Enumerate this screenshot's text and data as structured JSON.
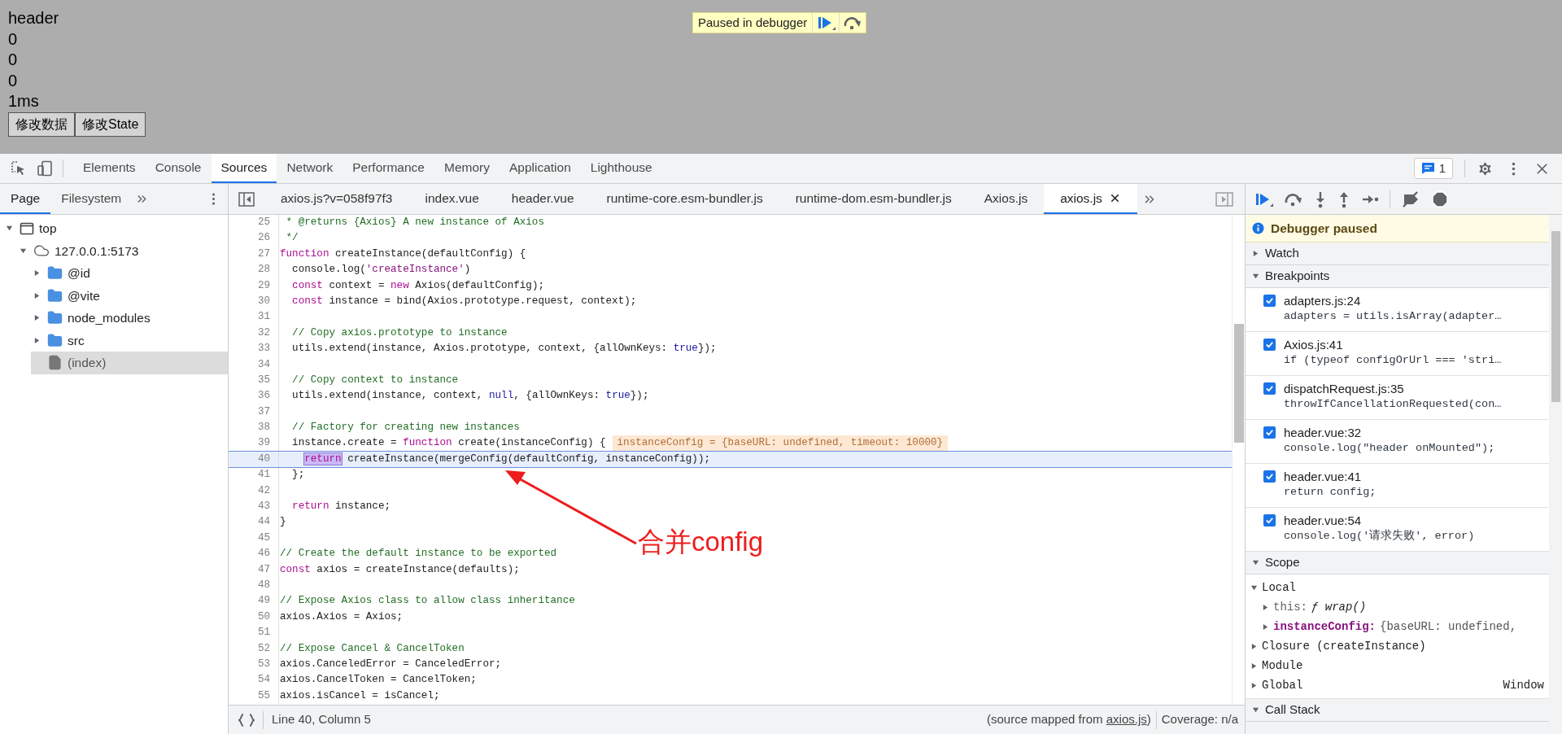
{
  "page": {
    "lines": [
      "header",
      "0",
      "0",
      "0",
      "1ms"
    ],
    "buttons": [
      "修改数据",
      "修改State"
    ],
    "paused_overlay": {
      "label": "Paused in debugger"
    }
  },
  "devtools": {
    "tabs": [
      {
        "label": "Elements",
        "selected": false
      },
      {
        "label": "Console",
        "selected": false
      },
      {
        "label": "Sources",
        "selected": true
      },
      {
        "label": "Network",
        "selected": false
      },
      {
        "label": "Performance",
        "selected": false
      },
      {
        "label": "Memory",
        "selected": false
      },
      {
        "label": "Application",
        "selected": false
      },
      {
        "label": "Lighthouse",
        "selected": false
      }
    ],
    "issues_count": "1"
  },
  "navigator": {
    "tabs": [
      {
        "label": "Page",
        "selected": true
      },
      {
        "label": "Filesystem",
        "selected": false
      }
    ],
    "tree": [
      {
        "label": "top",
        "kind": "frame",
        "expanded": true,
        "selected": false,
        "children": [
          {
            "label": "127.0.0.1:5173",
            "kind": "origin",
            "expanded": true,
            "selected": false,
            "children": [
              {
                "label": "@id",
                "kind": "folder",
                "expanded": false,
                "selected": false
              },
              {
                "label": "@vite",
                "kind": "folder",
                "expanded": false,
                "selected": false
              },
              {
                "label": "node_modules",
                "kind": "folder",
                "expanded": false,
                "selected": false
              },
              {
                "label": "src",
                "kind": "folder",
                "expanded": false,
                "selected": false
              },
              {
                "label": "(index)",
                "kind": "file",
                "selected": true
              }
            ]
          }
        ]
      }
    ]
  },
  "editor": {
    "tabs": [
      {
        "label": "axios.js?v=058f97f3",
        "selected": false
      },
      {
        "label": "index.vue",
        "selected": false
      },
      {
        "label": "header.vue",
        "selected": false
      },
      {
        "label": "runtime-core.esm-bundler.js",
        "selected": false
      },
      {
        "label": "runtime-dom.esm-bundler.js",
        "selected": false
      },
      {
        "label": "Axios.js",
        "selected": false
      },
      {
        "label": "axios.js",
        "selected": true
      }
    ],
    "lines": [
      {
        "number": "25",
        "current": false,
        "tokens": [
          {
            "kind": "comment",
            "text": " * @returns {Axios} A new instance of Axios"
          }
        ]
      },
      {
        "number": "26",
        "current": false,
        "tokens": [
          {
            "kind": "comment",
            "text": " */"
          }
        ]
      },
      {
        "number": "27",
        "current": false,
        "tokens": [
          {
            "kind": "keyword",
            "text": "function"
          },
          {
            "kind": "plain",
            "text": " createInstance(defaultConfig) {"
          }
        ]
      },
      {
        "number": "28",
        "current": false,
        "tokens": [
          {
            "kind": "plain",
            "text": "  console.log("
          },
          {
            "kind": "string",
            "text": "'createInstance'"
          },
          {
            "kind": "plain",
            "text": ")"
          }
        ]
      },
      {
        "number": "29",
        "current": false,
        "tokens": [
          {
            "kind": "keyword",
            "text": "  const"
          },
          {
            "kind": "plain",
            "text": " context = "
          },
          {
            "kind": "keyword",
            "text": "new"
          },
          {
            "kind": "plain",
            "text": " Axios(defaultConfig);"
          }
        ]
      },
      {
        "number": "30",
        "current": false,
        "tokens": [
          {
            "kind": "keyword",
            "text": "  const"
          },
          {
            "kind": "plain",
            "text": " instance = bind(Axios.prototype.request, context);"
          }
        ]
      },
      {
        "number": "31",
        "current": false
      },
      {
        "number": "32",
        "current": false,
        "tokens": [
          {
            "kind": "comment",
            "text": "  // Copy axios.prototype to instance"
          }
        ]
      },
      {
        "number": "33",
        "current": false,
        "tokens": [
          {
            "kind": "plain",
            "text": "  utils.extend(instance, Axios.prototype, context, {allOwnKeys: "
          },
          {
            "kind": "literal",
            "text": "true"
          },
          {
            "kind": "plain",
            "text": "});"
          }
        ]
      },
      {
        "number": "34",
        "current": false
      },
      {
        "number": "35",
        "current": false,
        "tokens": [
          {
            "kind": "comment",
            "text": "  // Copy context to instance"
          }
        ]
      },
      {
        "number": "36",
        "current": false,
        "tokens": [
          {
            "kind": "plain",
            "text": "  utils.extend(instance, context, "
          },
          {
            "kind": "literal",
            "text": "null"
          },
          {
            "kind": "plain",
            "text": ", {allOwnKeys: "
          },
          {
            "kind": "literal",
            "text": "true"
          },
          {
            "kind": "plain",
            "text": "});"
          }
        ]
      },
      {
        "number": "37",
        "current": false
      },
      {
        "number": "38",
        "current": false,
        "tokens": [
          {
            "kind": "comment",
            "text": "  // Factory for creating new instances"
          }
        ]
      },
      {
        "number": "39",
        "current": false,
        "tokens": [
          {
            "kind": "plain",
            "text": "  instance.create = "
          },
          {
            "kind": "keyword",
            "text": "function"
          },
          {
            "kind": "plain",
            "text": " create(instanceConfig) {"
          }
        ],
        "inline_value": "instanceConfig = {baseURL: undefined, timeout: 10000}"
      },
      {
        "number": "40",
        "current": true,
        "deep_indent": true,
        "tokens": [
          {
            "kind": "execution",
            "text": "return"
          },
          {
            "kind": "plain",
            "text": " createInstance(mergeConfig(defaultConfig, instanceConfig));"
          }
        ]
      },
      {
        "number": "41",
        "current": false,
        "tokens": [
          {
            "kind": "plain",
            "text": "  };"
          }
        ]
      },
      {
        "number": "42",
        "current": false
      },
      {
        "number": "43",
        "current": false,
        "tokens": [
          {
            "kind": "keyword",
            "text": "  return"
          },
          {
            "kind": "plain",
            "text": " instance;"
          }
        ]
      },
      {
        "number": "44",
        "current": false,
        "tokens": [
          {
            "kind": "plain",
            "text": "}"
          }
        ]
      },
      {
        "number": "45",
        "current": false
      },
      {
        "number": "46",
        "current": false,
        "tokens": [
          {
            "kind": "comment",
            "text": "// Create the default instance to be exported"
          }
        ]
      },
      {
        "number": "47",
        "current": false,
        "tokens": [
          {
            "kind": "keyword",
            "text": "const"
          },
          {
            "kind": "plain",
            "text": " axios = createInstance(defaults);"
          }
        ]
      },
      {
        "number": "48",
        "current": false
      },
      {
        "number": "49",
        "current": false,
        "tokens": [
          {
            "kind": "comment",
            "text": "// Expose Axios class to allow class inheritance"
          }
        ]
      },
      {
        "number": "50",
        "current": false,
        "tokens": [
          {
            "kind": "plain",
            "text": "axios.Axios = Axios;"
          }
        ]
      },
      {
        "number": "51",
        "current": false
      },
      {
        "number": "52",
        "current": false,
        "tokens": [
          {
            "kind": "comment",
            "text": "// Expose Cancel & CancelToken"
          }
        ]
      },
      {
        "number": "53",
        "current": false,
        "tokens": [
          {
            "kind": "plain",
            "text": "axios.CanceledError = CanceledError;"
          }
        ]
      },
      {
        "number": "54",
        "current": false,
        "tokens": [
          {
            "kind": "plain",
            "text": "axios.CancelToken = CancelToken;"
          }
        ]
      },
      {
        "number": "55",
        "current": false,
        "tokens": [
          {
            "kind": "plain",
            "text": "axios.isCancel = isCancel;"
          }
        ]
      }
    ],
    "annotation": {
      "text": "合并config"
    },
    "status_bar": {
      "position": "Line 40, Column 5",
      "source_prefix": "(source mapped from",
      "source_link": "axios.js",
      "source_suffix": ")",
      "coverage": "Coverage: n/a"
    }
  },
  "debugger": {
    "banner": "Debugger paused",
    "sections": [
      {
        "kind": "watch",
        "title": "Watch",
        "expanded": false
      },
      {
        "kind": "breakpoints",
        "title": "Breakpoints",
        "expanded": true,
        "items": [
          {
            "location": "adapters.js:24",
            "code": "adapters = utils.isArray(adapter…",
            "checked": true
          },
          {
            "location": "Axios.js:41",
            "code": "if (typeof configOrUrl === 'stri…",
            "checked": true
          },
          {
            "location": "dispatchRequest.js:35",
            "code": "throwIfCancellationRequested(con…",
            "checked": true
          },
          {
            "location": "header.vue:32",
            "code": "console.log(\"header onMounted\");",
            "checked": true
          },
          {
            "location": "header.vue:41",
            "code": "return config;",
            "checked": true
          },
          {
            "location": "header.vue:54",
            "code": "console.log('请求失败', error)",
            "checked": true
          }
        ]
      },
      {
        "kind": "scope",
        "title": "Scope",
        "expanded": true,
        "items": [
          {
            "label": "Local",
            "expanded": true,
            "children": [
              {
                "name": "this:",
                "value": "ƒ wrap()",
                "kind": "function",
                "emphasized": false,
                "expanded": false
              },
              {
                "name": "instanceConfig:",
                "value": "{baseURL: undefined,",
                "kind": "object",
                "emphasized": true,
                "expanded": false
              }
            ]
          },
          {
            "label": "Closure (createInstance)",
            "expanded": false
          },
          {
            "label": "Module",
            "expanded": false
          },
          {
            "label": "Global",
            "expanded": false,
            "value": "Window"
          }
        ]
      },
      {
        "kind": "call_stack",
        "title": "Call Stack",
        "expanded": true
      }
    ]
  }
}
